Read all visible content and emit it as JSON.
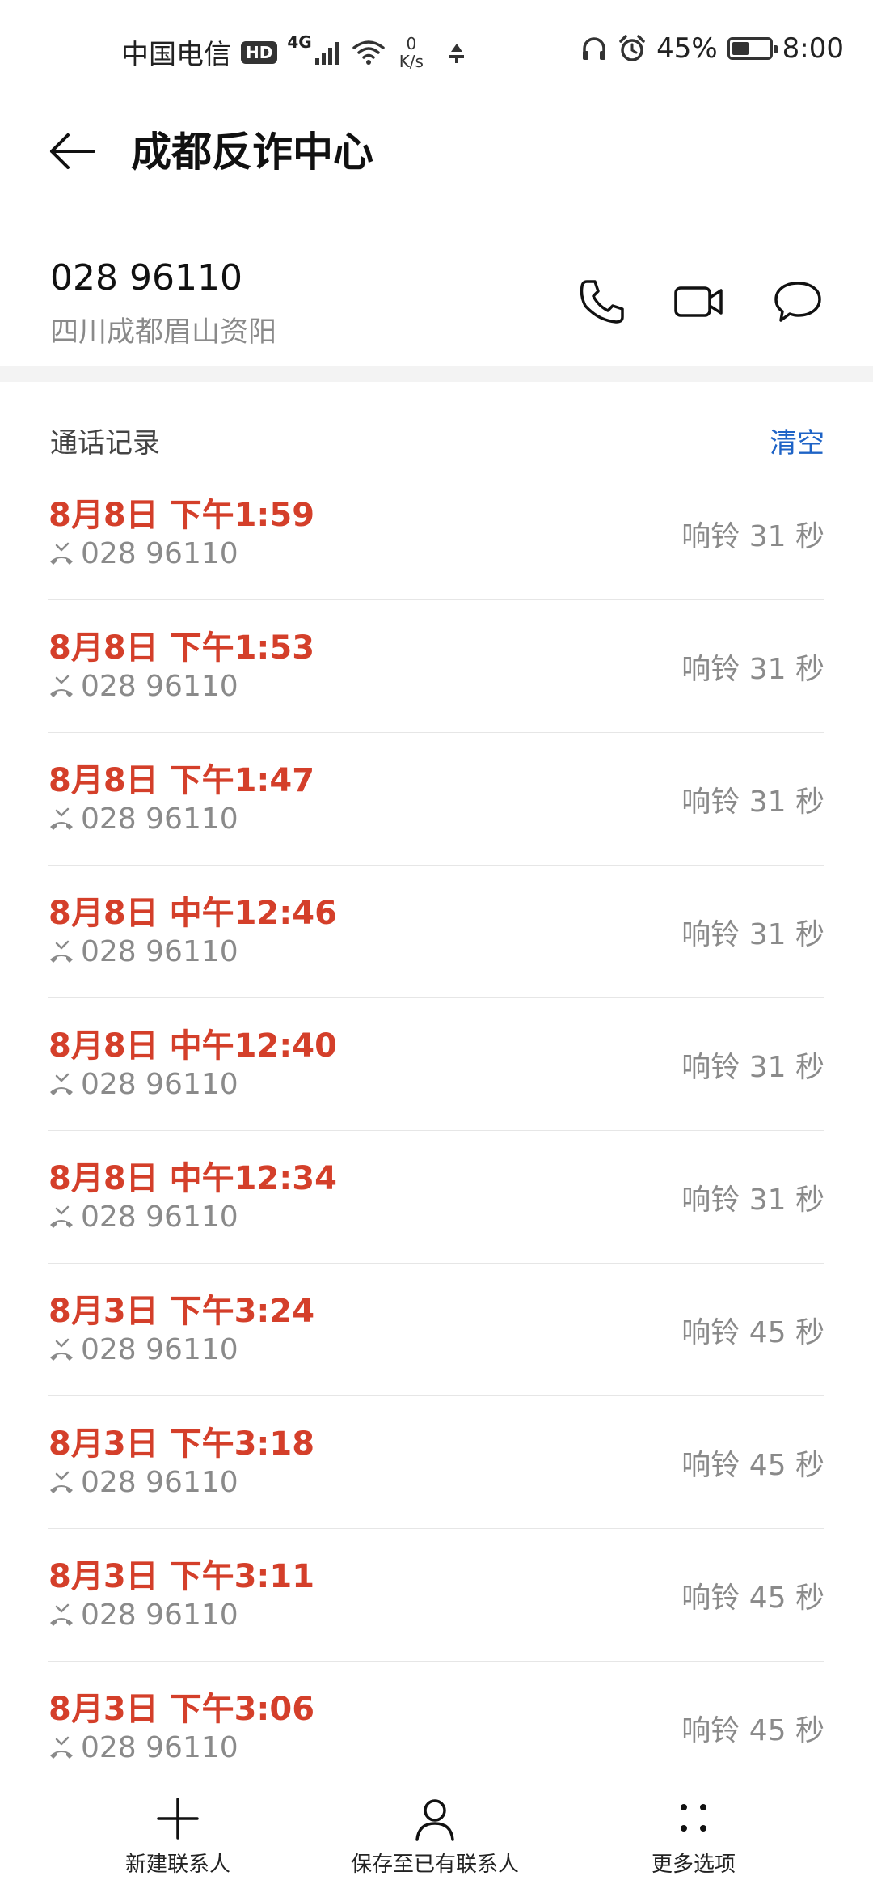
{
  "status_bar": {
    "carrier": "中国电信",
    "hd_badge": "HD",
    "network": "4G",
    "speed_value": "0",
    "speed_unit": "K/s",
    "battery_percent": "45%",
    "battery_level": 0.45,
    "time": "8:00"
  },
  "header": {
    "title": "成都反诈中心"
  },
  "contact": {
    "number": "028 96110",
    "location": "四川成都眉山资阳"
  },
  "call_log": {
    "title": "通话记录",
    "clear_label": "清空",
    "entries": [
      {
        "time": "8月8日 下午1:59",
        "number": "028 96110",
        "duration": "响铃 31 秒"
      },
      {
        "time": "8月8日 下午1:53",
        "number": "028 96110",
        "duration": "响铃 31 秒"
      },
      {
        "time": "8月8日 下午1:47",
        "number": "028 96110",
        "duration": "响铃 31 秒"
      },
      {
        "time": "8月8日 中午12:46",
        "number": "028 96110",
        "duration": "响铃 31 秒"
      },
      {
        "time": "8月8日 中午12:40",
        "number": "028 96110",
        "duration": "响铃 31 秒"
      },
      {
        "time": "8月8日 中午12:34",
        "number": "028 96110",
        "duration": "响铃 31 秒"
      },
      {
        "time": "8月3日 下午3:24",
        "number": "028 96110",
        "duration": "响铃 45 秒"
      },
      {
        "time": "8月3日 下午3:18",
        "number": "028 96110",
        "duration": "响铃 45 秒"
      },
      {
        "time": "8月3日 下午3:11",
        "number": "028 96110",
        "duration": "响铃 45 秒"
      },
      {
        "time": "8月3日 下午3:06",
        "number": "028 96110",
        "duration": "响铃 45 秒"
      }
    ]
  },
  "bottom_nav": {
    "new_contact": "新建联系人",
    "save_existing": "保存至已有联系人",
    "more_options": "更多选项"
  },
  "colors": {
    "missed": "#d43f2a",
    "accent": "#1e63c6",
    "secondary_text": "#8a8a8a"
  }
}
